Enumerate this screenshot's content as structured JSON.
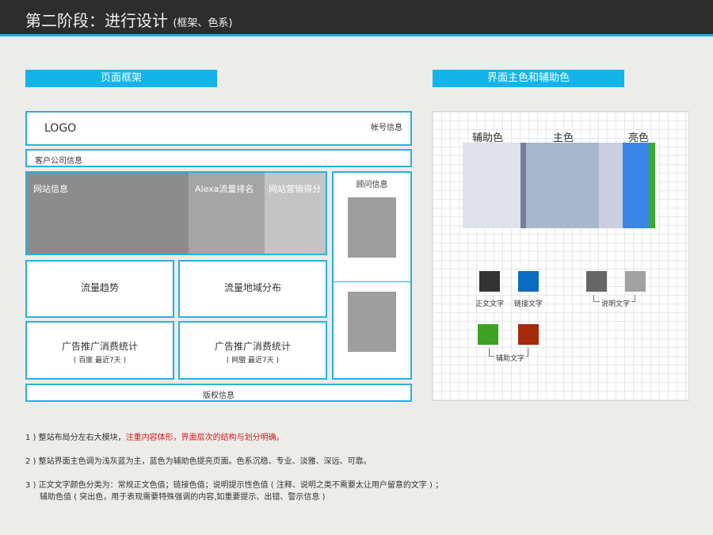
{
  "header": {
    "title": "第二阶段：进行设计",
    "subtitle": "(框架、色系)"
  },
  "sections": {
    "frame_title": "页面框架",
    "colors_title": "界面主色和辅助色"
  },
  "wireframe": {
    "logo": "LOGO",
    "account": "帐号信息",
    "company": "客户公司信息",
    "site_info": "网站信息",
    "alexa": "Alexa流量排名",
    "marketing": "网站营销得分",
    "advisor": "顾问信息",
    "traffic_trend": "流量趋势",
    "traffic_region": "流量地域分布",
    "ad_stats_1": "广告推广消费统计",
    "ad_stats_1_sub": "( 百度 最近7天 )",
    "ad_stats_2": "广告推广消费统计",
    "ad_stats_2_sub": "( 网盟 最近7天 )",
    "copyright": "版权信息"
  },
  "palette": {
    "label_secondary": "辅助色",
    "label_main": "主色",
    "label_bright": "亮色",
    "strips": [
      "#dfe2ea",
      "#727e99",
      "#a8b6cb",
      "#c9cfe0",
      "#3a86e6",
      "#3aaa2e"
    ],
    "swatches": {
      "body_text": {
        "label": "正文文字",
        "color": "#333333"
      },
      "link_text": {
        "label": "链接文字",
        "color": "#0a6cbf"
      },
      "desc_dark": {
        "color": "#666666"
      },
      "desc_light": {
        "color": "#a1a1a1"
      },
      "desc_label": "说明文字",
      "aux_green": {
        "color": "#3ca125"
      },
      "aux_red": {
        "color": "#a32a0a"
      },
      "aux_label": "辅助文字"
    }
  },
  "notes": {
    "n1_prefix": "1 ) 整站布局分左右大模块，",
    "n1_highlight": "注重内容体形，界面层次的结构与划分明确。",
    "n2": "2 ) 整站界面主色调为浅灰蓝为主，蓝色为辅助色提亮页面。色系沉稳、专业、淡雅、深远、可靠。",
    "n3_line1": "3 ) 正文文字颜色分类为：常规正文色值；链接色值；说明提示性色值 ( 注释、说明之类不需要太让用户留意的文字 ) ；",
    "n3_line2": "辅助色值 ( 突出色，用于表现需要特殊强调的内容,如重要提示、出错、警示信息 )"
  }
}
